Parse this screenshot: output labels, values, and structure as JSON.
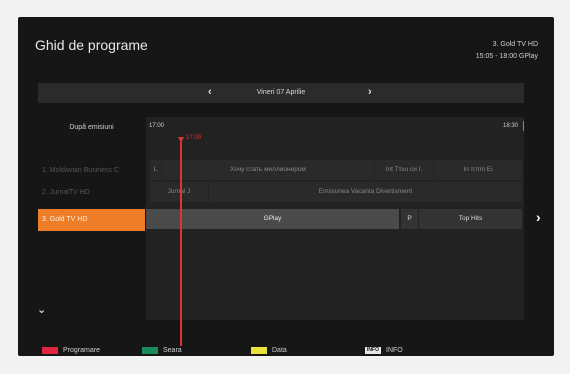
{
  "header": {
    "title": "Ghid de programe",
    "channel_now": "3. Gold TV HD",
    "program_now": "15:05 - 18:00 GPlay"
  },
  "date_nav": {
    "prev_icon": "chevron-left-icon",
    "next_icon": "chevron-right-icon",
    "date": "Vineri 07 Aprilie"
  },
  "filter": {
    "label": "Dupã emisiuni"
  },
  "timeline": {
    "start": "17:00",
    "end": "18:30",
    "now": "17:09"
  },
  "channels": [
    {
      "label": "1. Moldavian Business C"
    },
    {
      "label": "2. JurnalTV HD"
    },
    {
      "label": "3. Gold TV HD"
    }
  ],
  "rows": [
    {
      "programs": [
        {
          "title": "L"
        },
        {
          "title": "Хочу стать миллионером"
        },
        {
          "title": "Ιnt Ττνu си Ι."
        },
        {
          "title": "Ιn ππm Ει"
        }
      ]
    },
    {
      "programs": [
        {
          "title": "Jurnal J"
        },
        {
          "title": "Emisiunea Vacanta Divertisment"
        }
      ]
    },
    {
      "programs": [
        {
          "title": "GPlay"
        },
        {
          "title": "P"
        },
        {
          "title": "Top Hits"
        }
      ]
    }
  ],
  "nav": {
    "right_icon": "chevron-right-icon",
    "down_icon": "chevron-down-icon"
  },
  "legend": [
    {
      "label": "Programare",
      "color": "#e0263f"
    },
    {
      "label": "Seara",
      "color": "#1b8a5a"
    },
    {
      "label": "Data",
      "color": "#e7e23c"
    },
    {
      "label": "INFO",
      "key": "INFO"
    }
  ],
  "colors": {
    "accent": "#ee7d28",
    "now_line": "#dd3333"
  }
}
